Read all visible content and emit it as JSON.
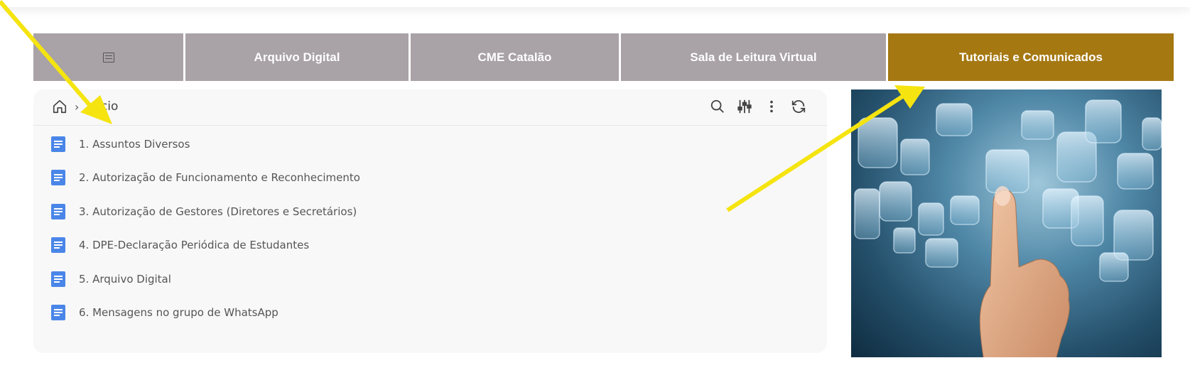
{
  "nav": {
    "menu_icon": "list-icon",
    "items": [
      {
        "label": "Arquivo Digital"
      },
      {
        "label": "CME Catalão"
      },
      {
        "label": "Sala de Leitura Virtual"
      },
      {
        "label": "Tutoriais e Comunicados",
        "active": true
      }
    ]
  },
  "breadcrumb": {
    "home_icon": "home-icon",
    "separator": "›",
    "current": "Início"
  },
  "toolbar": {
    "icons": [
      "search-icon",
      "sliders-icon",
      "more-vertical-icon",
      "refresh-icon"
    ]
  },
  "files": {
    "icon": "document-icon",
    "items": [
      {
        "label": "1. Assuntos Diversos"
      },
      {
        "label": "2. Autorização de Funcionamento e Reconhecimento"
      },
      {
        "label": "3. Autorização de Gestores (Diretores e Secretários)"
      },
      {
        "label": "4. DPE-Declaração Periódica de Estudantes"
      },
      {
        "label": "5. Arquivo Digital"
      },
      {
        "label": "6. Mensagens no grupo de WhatsApp"
      }
    ]
  },
  "colors": {
    "nav_bg": "#a9a2a6",
    "nav_active_bg": "#a57812",
    "doc_icon": "#4a86e8",
    "annotation_arrow": "#f5e410"
  },
  "hero_image": "finger-touching-glowing-squares"
}
